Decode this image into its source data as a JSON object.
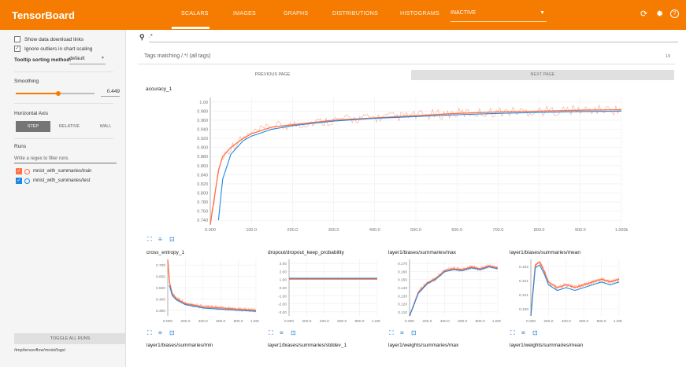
{
  "app": {
    "title": "TensorBoard",
    "accent": "#f57c00"
  },
  "nav": {
    "tabs": [
      {
        "label": "SCALARS",
        "active": true
      },
      {
        "label": "IMAGES"
      },
      {
        "label": "GRAPHS"
      },
      {
        "label": "DISTRIBUTIONS"
      },
      {
        "label": "HISTOGRAMS"
      }
    ],
    "inactive_select": "INACTIVE",
    "icons": [
      "refresh-icon",
      "settings-icon",
      "help-icon"
    ]
  },
  "sidebar": {
    "show_download": {
      "label": "Show data download links",
      "checked": false
    },
    "ignore_outliers": {
      "label": "Ignore outliers in chart scaling",
      "checked": true
    },
    "tooltip_label": "Tooltip sorting method:",
    "tooltip_value": "default",
    "smoothing_label": "Smoothing",
    "smoothing_value": "0.449",
    "axis_label": "Horizontal Axis",
    "axis_options": [
      "STEP",
      "RELATIVE",
      "WALL"
    ],
    "axis_selected": "STEP",
    "runs_label": "Runs",
    "runs_filter_placeholder": "Write a regex to filter runs",
    "runs": [
      {
        "name": "mnist_with_summaries/train",
        "color": "#ff7043"
      },
      {
        "name": "mnist_with_summaries/test",
        "color": "#1e88e5"
      }
    ],
    "toggle_label": "TOGGLE ALL RUNS",
    "logdir": "/tmp/tensorflow/mnist/logs/"
  },
  "main": {
    "search_value": ".*",
    "tags_matching": "Tags matching /.*/ (all tags)",
    "tags_count": "19",
    "prev_page": "PREVIOUS PAGE",
    "next_page": "NEXT PAGE",
    "bottom_titles": [
      "layer1/biases/summaries/min",
      "layer1/biases/summaries/stddev_1",
      "layer1/weights/summaries/max",
      "layer1/weights/summaries/mean"
    ]
  },
  "chart_data": [
    {
      "type": "line",
      "title": "accuracy_1",
      "xlabel": "",
      "ylabel": "",
      "xlim": [
        0,
        1000
      ],
      "ylim": [
        0.72,
        1.0
      ],
      "xticks": [
        "0.000",
        "100.0",
        "200.0",
        "300.0",
        "400.0",
        "500.0",
        "600.0",
        "700.0",
        "800.0",
        "900.0",
        "1.000k"
      ],
      "yticks": [
        "0.740",
        "0.760",
        "0.780",
        "0.800",
        "0.820",
        "0.840",
        "0.860",
        "0.880",
        "0.900",
        "0.920",
        "0.940",
        "0.960",
        "0.980",
        "1.00"
      ],
      "series": [
        {
          "name": "mnist_with_summaries/train",
          "color": "#ff7043",
          "x": [
            0,
            10,
            20,
            30,
            50,
            80,
            100,
            150,
            200,
            300,
            400,
            500,
            600,
            700,
            800,
            900,
            1000
          ],
          "values": [
            0.72,
            0.78,
            0.84,
            0.87,
            0.89,
            0.91,
            0.92,
            0.935,
            0.94,
            0.95,
            0.955,
            0.96,
            0.965,
            0.968,
            0.97,
            0.972,
            0.973
          ]
        },
        {
          "name": "mnist_with_summaries/test",
          "color": "#1e88e5",
          "x": [
            20,
            30,
            50,
            80,
            100,
            150,
            200,
            300,
            400,
            500,
            600,
            700,
            800,
            900,
            1000
          ],
          "values": [
            0.73,
            0.82,
            0.875,
            0.905,
            0.915,
            0.93,
            0.938,
            0.948,
            0.954,
            0.958,
            0.962,
            0.965,
            0.967,
            0.969,
            0.97
          ]
        }
      ]
    },
    {
      "type": "line",
      "title": "cross_entropy_1",
      "xlim": [
        0,
        1000
      ],
      "ylim": [
        0.25,
        0.75
      ],
      "yticks": [
        "0.300",
        "0.400",
        "0.500",
        "0.600",
        "0.700"
      ],
      "xticks": [
        "0.000",
        "200.0",
        "400.0",
        "600.0",
        "800.0",
        "1.000k"
      ],
      "series": [
        {
          "name": "mnist_with_summaries/train",
          "color": "#ff7043",
          "x": [
            0,
            20,
            50,
            100,
            200,
            400,
            600,
            800,
            1000
          ],
          "values": [
            0.75,
            0.55,
            0.45,
            0.4,
            0.36,
            0.33,
            0.32,
            0.31,
            0.3
          ]
        },
        {
          "name": "mnist_with_summaries/test",
          "color": "#1e88e5",
          "x": [
            20,
            50,
            100,
            200,
            400,
            600,
            800,
            1000
          ],
          "values": [
            0.52,
            0.43,
            0.39,
            0.35,
            0.32,
            0.31,
            0.3,
            0.29
          ]
        }
      ]
    },
    {
      "type": "line",
      "title": "dropout/dropout_keep_probability",
      "xlim": [
        0,
        1000
      ],
      "ylim": [
        -3,
        3
      ],
      "yticks": [
        "-3.00",
        "-2.00",
        "-1.00",
        "0.00",
        "1.00",
        "2.00",
        "3.00"
      ],
      "xticks": [
        "0.000",
        "200.0",
        "400.0",
        "600.0",
        "800.0",
        "1.000k"
      ],
      "series": [
        {
          "name": "mnist_with_summaries/train",
          "color": "#ff7043",
          "x": [
            0,
            1000
          ],
          "values": [
            0.9,
            0.9
          ]
        },
        {
          "name": "mnist_with_summaries/test",
          "color": "#1e88e5",
          "x": [
            0,
            1000
          ],
          "values": [
            1.0,
            1.0
          ]
        }
      ]
    },
    {
      "type": "line",
      "title": "layer1/biases/summaries/max",
      "xlim": [
        0,
        1000
      ],
      "ylim": [
        0.11,
        0.17
      ],
      "yticks": [
        "0.110",
        "0.120",
        "0.130",
        "0.140",
        "0.150",
        "0.160",
        "0.170"
      ],
      "xticks": [
        "0.000",
        "200.0",
        "400.0",
        "600.0",
        "800.0",
        "1.000k"
      ],
      "series": [
        {
          "name": "mnist_with_summaries/train",
          "color": "#ff7043",
          "x": [
            0,
            100,
            200,
            300,
            400,
            500,
            600,
            700,
            800,
            900,
            1000
          ],
          "values": [
            0.11,
            0.135,
            0.145,
            0.15,
            0.158,
            0.16,
            0.159,
            0.162,
            0.16,
            0.163,
            0.161
          ]
        },
        {
          "name": "mnist_with_summaries/test",
          "color": "#1e88e5",
          "x": [
            0,
            100,
            200,
            300,
            400,
            500,
            600,
            700,
            800,
            900,
            1000
          ],
          "values": [
            0.11,
            0.134,
            0.144,
            0.149,
            0.157,
            0.159,
            0.158,
            0.161,
            0.159,
            0.162,
            0.16
          ]
        }
      ]
    },
    {
      "type": "line",
      "title": "layer1/biases/summaries/mean",
      "xlim": [
        0,
        1000
      ],
      "ylim": [
        0.1,
        0.102
      ],
      "yticks": [
        "0.100",
        "0.101",
        "0.101",
        "0.102"
      ],
      "xticks": [
        "0.000",
        "200.0",
        "400.0",
        "600.0",
        "800.0",
        "1.000k"
      ],
      "series": [
        {
          "name": "mnist_with_summaries/train",
          "color": "#ff7043",
          "x": [
            0,
            50,
            100,
            150,
            200,
            300,
            400,
            500,
            600,
            700,
            800,
            900,
            1000
          ],
          "values": [
            0.1,
            0.1018,
            0.1019,
            0.1016,
            0.1012,
            0.101,
            0.1011,
            0.101,
            0.1011,
            0.1012,
            0.1013,
            0.1012,
            0.1013
          ]
        },
        {
          "name": "mnist_with_summaries/test",
          "color": "#1e88e5",
          "x": [
            0,
            50,
            100,
            150,
            200,
            300,
            400,
            500,
            600,
            700,
            800,
            900,
            1000
          ],
          "values": [
            0.1,
            0.1017,
            0.1018,
            0.1015,
            0.1011,
            0.1009,
            0.101,
            0.1009,
            0.101,
            0.1011,
            0.1012,
            0.1011,
            0.1012
          ]
        }
      ]
    }
  ]
}
